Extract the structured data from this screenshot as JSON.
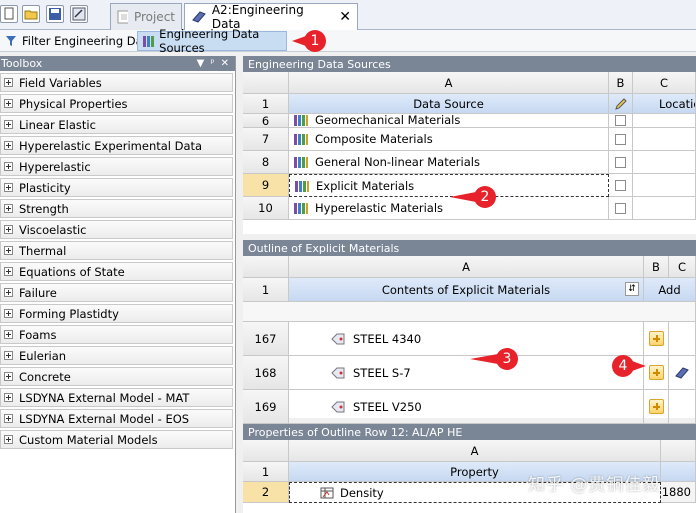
{
  "tabs": [
    {
      "label": "Project",
      "active": false
    },
    {
      "label": "A2:Engineering Data",
      "active": true
    }
  ],
  "tab_close": "✕",
  "toolbar": {
    "filter_label": "Filter Engineering Data",
    "sources_label": "Engineering Data Sources"
  },
  "toolbox": {
    "title": "Toolbox",
    "controls": [
      "▼",
      "ᵖ",
      "✕"
    ],
    "items": [
      "Field Variables",
      "Physical Properties",
      "Linear Elastic",
      "Hyperelastic Experimental Data",
      "Hyperelastic",
      "Plasticity",
      "Strength",
      "Viscoelastic",
      "Thermal",
      "Equations of State",
      "Failure",
      "Forming Plastidty",
      "Foams",
      "Eulerian",
      "Concrete",
      "LSDYNA External Model - MAT",
      "LSDYNA External Model - EOS",
      "Custom Material Models"
    ]
  },
  "sources_panel": {
    "title": "Engineering Data Sources",
    "col_a": "A",
    "col_b": "B",
    "col_c": "C",
    "header_row": "1",
    "header_source": "Data Source",
    "header_location": "Locatio",
    "rows": [
      {
        "num": "6",
        "label": "Geomechanical Materials"
      },
      {
        "num": "7",
        "label": "Composite Materials"
      },
      {
        "num": "8",
        "label": "General Non-linear Materials"
      },
      {
        "num": "9",
        "label": "Explicit Materials",
        "selected": true
      },
      {
        "num": "10",
        "label": "Hyperelastic Materials"
      }
    ]
  },
  "outline_panel": {
    "title": "Outline of Explicit Materials",
    "col_a": "A",
    "col_b": "B",
    "col_c": "C",
    "header_row": "1",
    "header_contents": "Contents of Explicit Materials",
    "header_add": "Add",
    "rows": [
      {
        "num": "167",
        "label": "STEEL 4340"
      },
      {
        "num": "168",
        "label": "STEEL S-7"
      },
      {
        "num": "169",
        "label": "STEEL V250"
      }
    ]
  },
  "properties_panel": {
    "title": "Properties of Outline Row 12: AL/AP HE",
    "col_a": "A",
    "header_row": "1",
    "header_property": "Property",
    "rows": [
      {
        "num": "2",
        "label": "Density",
        "value": "1880"
      }
    ]
  },
  "callouts": [
    "1",
    "2",
    "3",
    "4"
  ],
  "watermark": "知乎 @费铜佳毅",
  "colors": {
    "callout": "#e8222a",
    "panel_header": "#7a8696",
    "selected_row": "#f8e2a8"
  }
}
